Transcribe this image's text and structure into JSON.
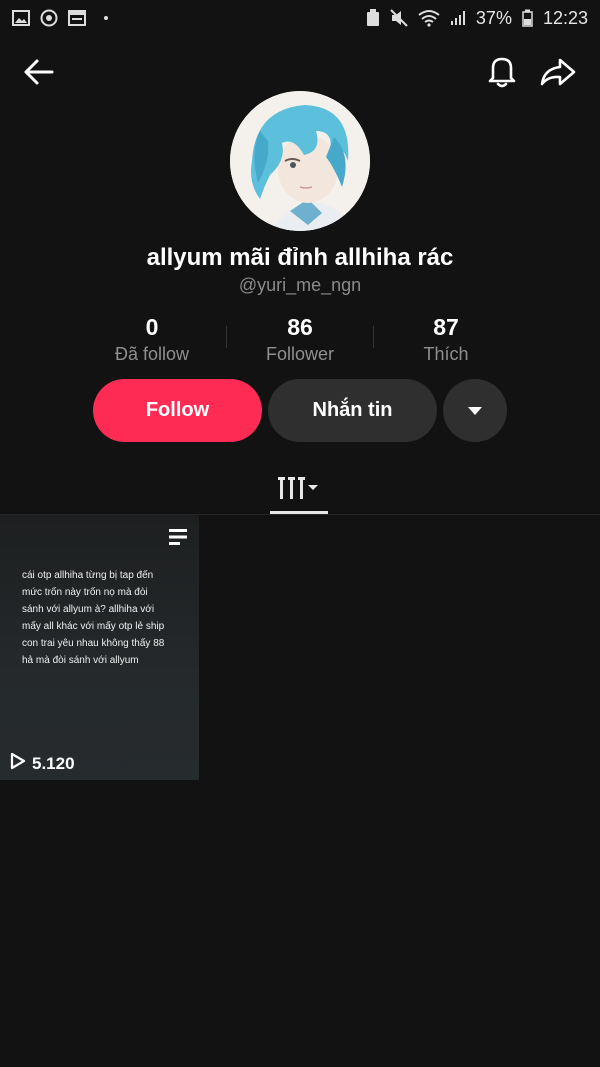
{
  "status_bar": {
    "battery_percent": "37%",
    "time": "12:23",
    "icons_left": [
      "gallery-icon",
      "sync-icon",
      "calendar-icon"
    ],
    "icons_right": [
      "battery-saver-icon",
      "mute-icon",
      "wifi-icon",
      "signal-icon",
      "battery-icon"
    ]
  },
  "header": {
    "back_icon": "arrow-left-icon",
    "bell_icon": "bell-icon",
    "share_icon": "share-arrow-icon"
  },
  "profile": {
    "display_name": "allyum mãi đỉnh allhiha rác",
    "username": "@yuri_me_ngn",
    "stats": [
      {
        "value": "0",
        "label": "Đã follow"
      },
      {
        "value": "86",
        "label": "Follower"
      },
      {
        "value": "87",
        "label": "Thích"
      }
    ]
  },
  "actions": {
    "follow_label": "Follow",
    "message_label": "Nhắn tin",
    "follow_color": "#fe2c55"
  },
  "tabs": {
    "active_icon": "grid-columns-icon"
  },
  "videos": [
    {
      "text": "cái otp allhiha từng bị tap đến mức trốn này trốn nọ mà đòi sánh với allyum à? allhiha với mấy all khác với mấy otp lẻ ship con trai yêu nhau không thấy 88 hả mà đòi sánh với allyum",
      "views": "5.120"
    }
  ]
}
